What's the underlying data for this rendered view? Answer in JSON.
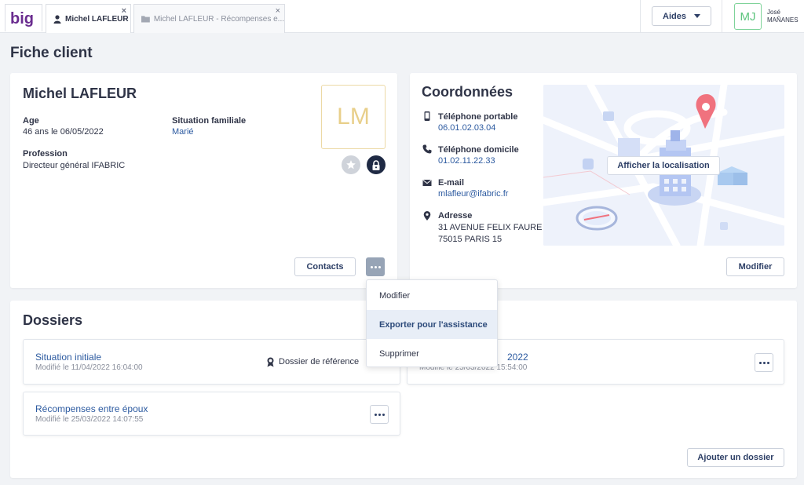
{
  "topbar": {
    "logo_text": "big",
    "tabs": [
      {
        "label": "Michel LAFLEUR",
        "icon": "person-icon"
      },
      {
        "label": "Michel LAFLEUR - Récompenses e...",
        "icon": "folder-icon"
      }
    ],
    "close_glyph": "×",
    "help_label": "Aides",
    "user": {
      "initials": "MJ",
      "first_name": "José",
      "last_name": "MAÑANES"
    }
  },
  "page_title": "Fiche client",
  "client": {
    "name": "Michel LAFLEUR",
    "age_label": "Age",
    "age_value": "46 ans le 06/05/2022",
    "situation_label": "Situation familiale",
    "situation_value": "Marié",
    "profession_label": "Profession",
    "profession_value": "Directeur général IFABRIC",
    "initials": "LM",
    "contacts_label": "Contacts"
  },
  "coordonnees": {
    "title": "Coordonnées",
    "mobile_label": "Téléphone portable",
    "mobile_value": "06.01.02.03.04",
    "home_label": "Téléphone domicile",
    "home_value": "01.02.11.22.33",
    "email_label": "E-mail",
    "email_value": "mlafleur@ifabric.fr",
    "address_label": "Adresse",
    "address_line1": "31 AVENUE FELIX FAURE",
    "address_line2": "75015 PARIS 15",
    "map_button": "Afficher la localisation",
    "modify_label": "Modifier"
  },
  "context_menu": {
    "items": [
      "Modifier",
      "Exporter pour l'assistance",
      "Supprimer"
    ],
    "highlighted_index": 1
  },
  "dossiers": {
    "title": "Dossiers",
    "items": [
      {
        "title": "Situation initiale",
        "modified": "Modifié le 11/04/2022 16:04:00",
        "badge": "Dossier de référence"
      },
      {
        "title": "2022",
        "modified": "Modifié le 25/03/2022 15:54:00"
      },
      {
        "title": "Récompenses entre époux",
        "modified": "Modifié le 25/03/2022 14:07:55"
      }
    ],
    "add_label": "Ajouter un dossier"
  },
  "colors": {
    "accent": "#2c5aa0",
    "map_pin": "#f0727e",
    "monogram": "#e8cf8a"
  }
}
